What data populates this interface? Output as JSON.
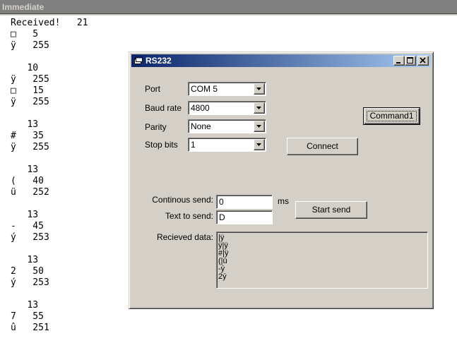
{
  "immediate": {
    "title": "Immediate",
    "lines": [
      "Received!   21",
      "□   5",
      "ÿ   255",
      "",
      "   10",
      "ÿ   255",
      "□   15",
      "ÿ   255",
      "",
      "   13",
      "#   35",
      "ÿ   255",
      "",
      "   13",
      "(   40",
      "ü   252",
      "",
      "   13",
      "-   45",
      "ý   253",
      "",
      "   13",
      "2   50",
      "ý   253",
      "",
      "   13",
      "7   55",
      "û   251"
    ]
  },
  "window": {
    "title": "RS232",
    "port_label": "Port",
    "port_value": "COM 5",
    "baud_label": "Baud rate",
    "baud_value": "4800",
    "parity_label": "Parity",
    "parity_value": "None",
    "stopbits_label": "Stop bits",
    "stopbits_value": "1",
    "command1_label": "Command1",
    "connect_label": "Connect",
    "continous_label": "Continous send:",
    "continous_value": "0",
    "ms_label": "ms",
    "text_label": "Text to send:",
    "text_value": "D",
    "start_label": "Start send",
    "recieved_label": "Recieved data:",
    "recieved_lines": [
      "|ÿ",
      "ÿ|ÿ",
      "#|ÿ",
      "(|ü",
      "-ý",
      "2ý"
    ]
  },
  "icons": [
    "app-icon",
    "minimize-icon",
    "maximize-icon",
    "close-icon",
    "dropdown-arrow-icon"
  ]
}
